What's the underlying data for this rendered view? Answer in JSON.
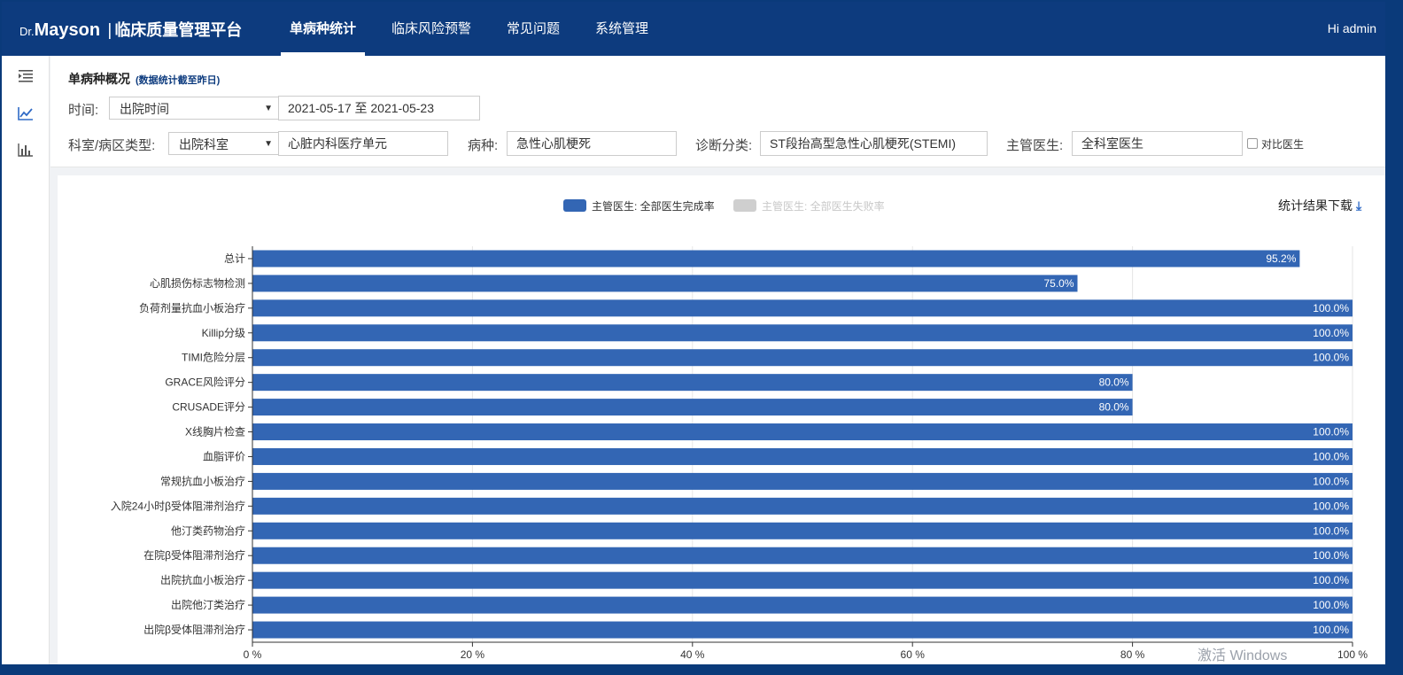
{
  "app": {
    "brand_dr": "Dr.",
    "brand_name": "Mayson",
    "brand_sep": "|",
    "platform": "临床质量管理平台",
    "greeting": "Hi  admin"
  },
  "nav": [
    {
      "label": "单病种统计",
      "active": true
    },
    {
      "label": "临床风险预警",
      "active": false
    },
    {
      "label": "常见问题",
      "active": false
    },
    {
      "label": "系统管理",
      "active": false
    }
  ],
  "sidebar": {
    "icons": [
      "collapse-menu-icon",
      "line-chart-icon",
      "bar-chart-icon"
    ]
  },
  "filters": {
    "title": "单病种概况",
    "subtitle": "(数据统计截至昨日)",
    "time_label": "时间:",
    "time_type": "出院时间",
    "date_range": "2021-05-17 至 2021-05-23",
    "dept_label": "科室/病区类型:",
    "dept_type": "出院科室",
    "dept_value": "心脏内科医疗单元",
    "disease_label": "病种:",
    "disease_value": "急性心肌梗死",
    "diag_label": "诊断分类:",
    "diag_value": "ST段抬高型急性心肌梗死(STEMI)",
    "doctor_label": "主管医生:",
    "doctor_value": "全科室医生",
    "compare_label": "对比医生",
    "arrow": "▼"
  },
  "download_label": "统计结果下载",
  "download_icon": "⤓",
  "colors": {
    "series_complete": "#3366b4",
    "series_fail": "#cfcfcf"
  },
  "chart_data": {
    "type": "bar",
    "orientation": "horizontal",
    "categories": [
      "总计",
      "心肌损伤标志物检测",
      "负荷剂量抗血小板治疗",
      "Killip分级",
      "TIMI危险分层",
      "GRACE风险评分",
      "CRUSADE评分",
      "X线胸片检查",
      "血脂评价",
      "常规抗血小板治疗",
      "入院24小时β受体阻滞剂治疗",
      "他汀类药物治疗",
      "在院β受体阻滞剂治疗",
      "出院抗血小板治疗",
      "出院他汀类治疗",
      "出院β受体阻滞剂治疗"
    ],
    "series": [
      {
        "name": "主管医生: 全部医生完成率",
        "values": [
          95.2,
          75.0,
          100.0,
          100.0,
          100.0,
          80.0,
          80.0,
          100.0,
          100.0,
          100.0,
          100.0,
          100.0,
          100.0,
          100.0,
          100.0,
          100.0
        ]
      },
      {
        "name": "主管医生: 全部医生失败率",
        "values": []
      }
    ],
    "data_labels": [
      "95.2%",
      "75.0%",
      "100.0%",
      "100.0%",
      "100.0%",
      "80.0%",
      "80.0%",
      "100.0%",
      "100.0%",
      "100.0%",
      "100.0%",
      "100.0%",
      "100.0%",
      "100.0%",
      "100.0%",
      "100.0%"
    ],
    "x_ticks": [
      "0 %",
      "20 %",
      "40 %",
      "60 %",
      "80 %",
      "100 %"
    ],
    "xlim": [
      0,
      100
    ],
    "grid": true,
    "legend_position": "top-center"
  },
  "watermark": "激活 Windows"
}
